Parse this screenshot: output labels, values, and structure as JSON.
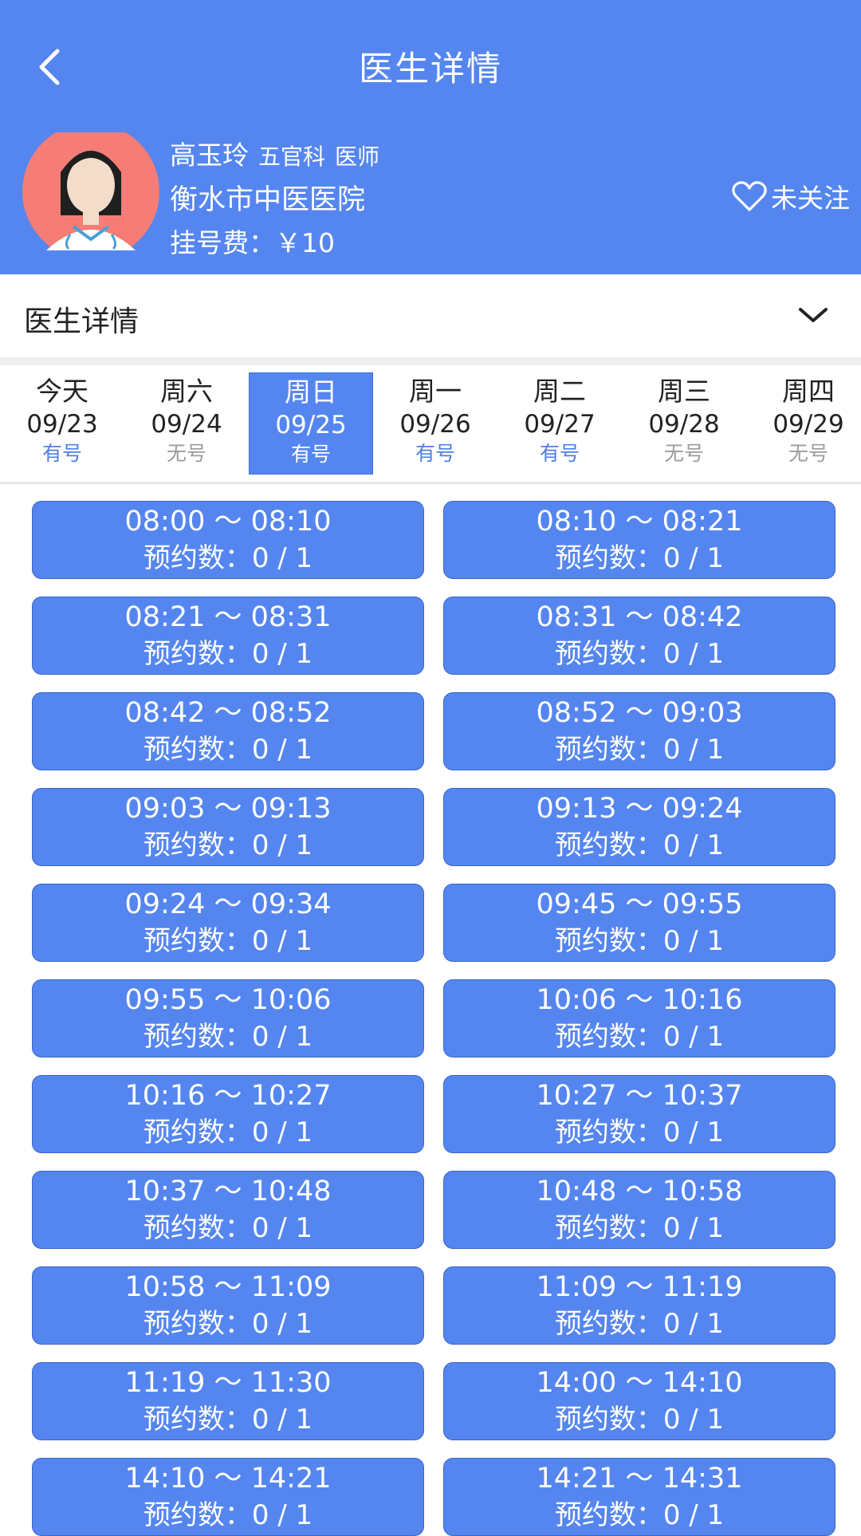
{
  "header": {
    "title": "医生详情",
    "doctor_name": "高玉玲",
    "department": "五官科",
    "title_role": "医师",
    "hospital": "衡水市中医医院",
    "fee_label": "挂号费：",
    "fee_value": "￥10",
    "follow_label": "未关注"
  },
  "section": {
    "title": "医生详情"
  },
  "dates": [
    {
      "weekday": "今天",
      "date": "09/23",
      "status": "有号"
    },
    {
      "weekday": "周六",
      "date": "09/24",
      "status": "无号"
    },
    {
      "weekday": "周日",
      "date": "09/25",
      "status": "有号"
    },
    {
      "weekday": "周一",
      "date": "09/26",
      "status": "有号"
    },
    {
      "weekday": "周二",
      "date": "09/27",
      "status": "有号"
    },
    {
      "weekday": "周三",
      "date": "09/28",
      "status": "无号"
    },
    {
      "weekday": "周四",
      "date": "09/29",
      "status": "无号"
    }
  ],
  "selected_date_index": 2,
  "slots": [
    {
      "time": "08:00 ～ 08:10",
      "count": "预约数：0 / 1"
    },
    {
      "time": "08:10 ～ 08:21",
      "count": "预约数：0 / 1"
    },
    {
      "time": "08:21 ～ 08:31",
      "count": "预约数：0 / 1"
    },
    {
      "time": "08:31 ～ 08:42",
      "count": "预约数：0 / 1"
    },
    {
      "time": "08:42 ～ 08:52",
      "count": "预约数：0 / 1"
    },
    {
      "time": "08:52 ～ 09:03",
      "count": "预约数：0 / 1"
    },
    {
      "time": "09:03 ～ 09:13",
      "count": "预约数：0 / 1"
    },
    {
      "time": "09:13 ～ 09:24",
      "count": "预约数：0 / 1"
    },
    {
      "time": "09:24 ～ 09:34",
      "count": "预约数：0 / 1"
    },
    {
      "time": "09:45 ～ 09:55",
      "count": "预约数：0 / 1"
    },
    {
      "time": "09:55 ～ 10:06",
      "count": "预约数：0 / 1"
    },
    {
      "time": "10:06 ～ 10:16",
      "count": "预约数：0 / 1"
    },
    {
      "time": "10:16 ～ 10:27",
      "count": "预约数：0 / 1"
    },
    {
      "time": "10:27 ～ 10:37",
      "count": "预约数：0 / 1"
    },
    {
      "time": "10:37 ～ 10:48",
      "count": "预约数：0 / 1"
    },
    {
      "time": "10:48 ～ 10:58",
      "count": "预约数：0 / 1"
    },
    {
      "time": "10:58 ～ 11:09",
      "count": "预约数：0 / 1"
    },
    {
      "time": "11:09 ～ 11:19",
      "count": "预约数：0 / 1"
    },
    {
      "time": "11:19 ～ 11:30",
      "count": "预约数：0 / 1"
    },
    {
      "time": "14:00 ～ 14:10",
      "count": "预约数：0 / 1"
    },
    {
      "time": "14:10 ～ 14:21",
      "count": "预约数：0 / 1"
    },
    {
      "time": "14:21 ～ 14:31",
      "count": "预约数：0 / 1"
    }
  ],
  "icons": {
    "back": "back-arrow-icon",
    "avatar": "doctor-avatar",
    "follow": "heart-outline-icon",
    "expand": "chevron-down-icon"
  },
  "colors": {
    "primary": "#5586f0",
    "available": "#4f7fe6",
    "unavailable": "#9c9c9c"
  }
}
